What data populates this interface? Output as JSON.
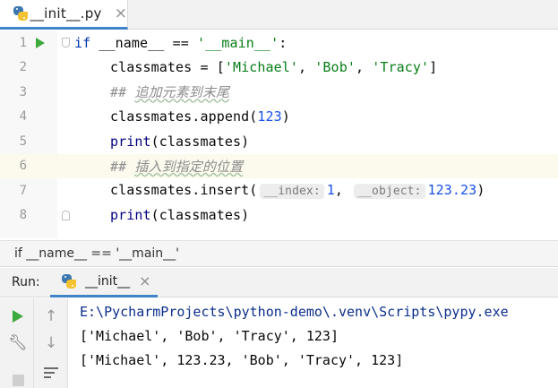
{
  "editor": {
    "tab": {
      "filename": "__init__.py",
      "close_glyph": "×",
      "icon": "python-file-icon"
    },
    "lines": [
      {
        "num": "1",
        "parts": [
          {
            "t": "if",
            "c": "kw"
          },
          {
            "t": " __name__ == "
          },
          {
            "t": "'__main__'",
            "c": "str"
          },
          {
            "t": ":"
          }
        ]
      },
      {
        "num": "2",
        "parts": [
          {
            "t": "classmates = ["
          },
          {
            "t": "'Michael'",
            "c": "str"
          },
          {
            "t": ", "
          },
          {
            "t": "'Bob'",
            "c": "str"
          },
          {
            "t": ", "
          },
          {
            "t": "'Tracy'",
            "c": "str"
          },
          {
            "t": "]"
          }
        ]
      },
      {
        "num": "3",
        "comment_prefix": "## ",
        "comment_text": "追加元素到末尾"
      },
      {
        "num": "4",
        "parts": [
          {
            "t": "classmates.append("
          },
          {
            "t": "123",
            "c": "num"
          },
          {
            "t": ")"
          }
        ]
      },
      {
        "num": "5",
        "parts": [
          {
            "t": "print",
            "c": "bi"
          },
          {
            "t": "(classmates)"
          }
        ]
      },
      {
        "num": "6",
        "comment_prefix": "## ",
        "comment_text": "插入到指定的位置"
      },
      {
        "num": "7",
        "call": "classmates.insert(",
        "hint1": "__index:",
        "arg1": "1",
        "sep": ", ",
        "hint2": "__object:",
        "arg2": "123.23",
        "close": ")"
      },
      {
        "num": "8",
        "parts": [
          {
            "t": "print",
            "c": "bi"
          },
          {
            "t": "(classmates)"
          }
        ]
      }
    ],
    "breadcrumb": "if __name__ == '__main__'"
  },
  "run_panel": {
    "title": "Run:",
    "tab_label": "__init__",
    "close_glyph": "×",
    "console": [
      "E:\\PycharmProjects\\python-demo\\.venv\\Scripts\\pypy.exe",
      "['Michael', 'Bob', 'Tracy', 123]",
      "['Michael', 123.23, 'Bob', 'Tracy', 123]"
    ]
  },
  "colors": {
    "keyword": "#0033b3",
    "string": "#067d17",
    "number": "#1750eb",
    "builtin": "#000080",
    "comment": "#8c8c8c",
    "accent": "#4083c9",
    "run_green": "#3daa3d"
  }
}
